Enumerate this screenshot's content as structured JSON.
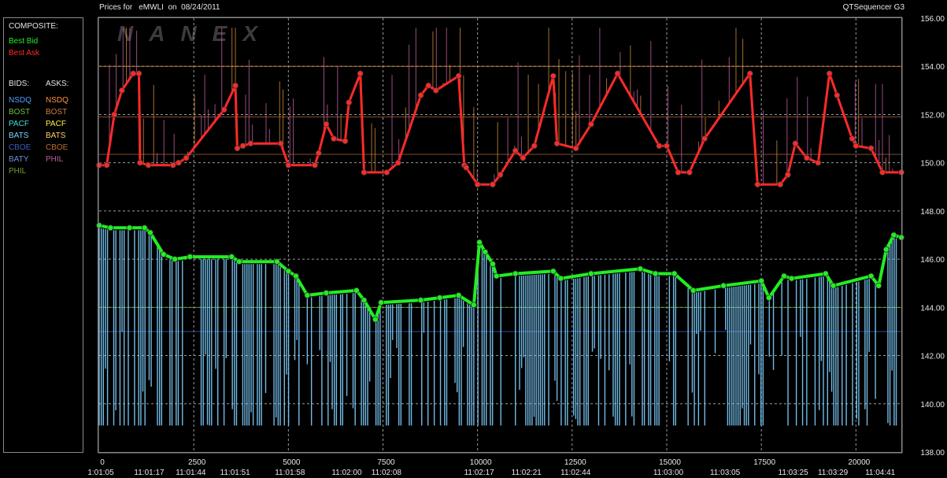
{
  "header": {
    "prices_label": "Prices for",
    "symbol": "eMWLI",
    "on_label": "on",
    "date": "08/24/2011",
    "app_name": "QTSequencer G3"
  },
  "watermark": "NANEX",
  "legend": {
    "composite_header": "COMPOSITE:",
    "best_bid": {
      "label": "Best Bid",
      "color": "#22ee22"
    },
    "best_ask": {
      "label": "Best Ask",
      "color": "#ff2a2a"
    },
    "bids_header": "BIDS:",
    "asks_header": "ASKS:",
    "bids": [
      {
        "label": "NSDQ",
        "color": "#4f9fff"
      },
      {
        "label": "BOST",
        "color": "#6fbf3f"
      },
      {
        "label": "PACF",
        "color": "#3fdfdf"
      },
      {
        "label": "BATS",
        "color": "#7fd0ff"
      },
      {
        "label": "CBOE",
        "color": "#3a5fbf"
      },
      {
        "label": "BATY",
        "color": "#6f8fdf"
      },
      {
        "label": "PHIL",
        "color": "#6f9f2f"
      }
    ],
    "asks": [
      {
        "label": "NSDQ",
        "color": "#ff8f3f"
      },
      {
        "label": "BOST",
        "color": "#d07f3f"
      },
      {
        "label": "PACF",
        "color": "#ffef3f"
      },
      {
        "label": "BATS",
        "color": "#ffcf6f"
      },
      {
        "label": "CBOE",
        "color": "#bf6f2f"
      },
      {
        "label": "PHIL",
        "color": "#bf5f9f"
      }
    ]
  },
  "chart_data": {
    "type": "line",
    "ylim": [
      138,
      156
    ],
    "xlim": [
      0,
      21200
    ],
    "y_ticks": [
      "138.00",
      "140.00",
      "142.00",
      "144.00",
      "146.00",
      "148.00",
      "150.00",
      "152.00",
      "154.00",
      "156.00"
    ],
    "x_ticks": [
      {
        "value": 0,
        "label": "0"
      },
      {
        "value": 2500,
        "label": "2500"
      },
      {
        "value": 5000,
        "label": "5000"
      },
      {
        "value": 7500,
        "label": "7500"
      },
      {
        "value": 10000,
        "label": "10000"
      },
      {
        "value": 12500,
        "label": "12500"
      },
      {
        "value": 15000,
        "label": "15000"
      },
      {
        "value": 17500,
        "label": "17500"
      },
      {
        "value": 20000,
        "label": "20000"
      }
    ],
    "time_labels": [
      {
        "x": 0,
        "label": "1:01:05"
      },
      {
        "x": 1280,
        "label": "11:01:17"
      },
      {
        "x": 2380,
        "label": "11:01:44"
      },
      {
        "x": 3550,
        "label": "11:01:51"
      },
      {
        "x": 5000,
        "label": "11:01:58"
      },
      {
        "x": 6500,
        "label": "11:02:00"
      },
      {
        "x": 7550,
        "label": "11:02:08"
      },
      {
        "x": 10000,
        "label": "11:02:17"
      },
      {
        "x": 11250,
        "label": "11:02:21"
      },
      {
        "x": 12550,
        "label": "11:02:44"
      },
      {
        "x": 15000,
        "label": "11:03:00"
      },
      {
        "x": 16500,
        "label": "11:03:05"
      },
      {
        "x": 18300,
        "label": "11:03:25"
      },
      {
        "x": 19350,
        "label": "11:03:29"
      },
      {
        "x": 20600,
        "label": "11:04:41"
      }
    ],
    "grid": true,
    "series": [
      {
        "name": "Best Bid",
        "color": "#22ee22",
        "points": [
          [
            0,
            147.4
          ],
          [
            300,
            147.3
          ],
          [
            800,
            147.3
          ],
          [
            1200,
            147.3
          ],
          [
            1350,
            147.1
          ],
          [
            1700,
            146.2
          ],
          [
            2000,
            146.0
          ],
          [
            2400,
            146.1
          ],
          [
            3500,
            146.1
          ],
          [
            3700,
            145.9
          ],
          [
            4700,
            145.9
          ],
          [
            5000,
            145.5
          ],
          [
            5200,
            145.3
          ],
          [
            5500,
            144.5
          ],
          [
            6000,
            144.6
          ],
          [
            6800,
            144.7
          ],
          [
            7000,
            144.3
          ],
          [
            7300,
            143.5
          ],
          [
            7450,
            144.2
          ],
          [
            8500,
            144.3
          ],
          [
            9000,
            144.4
          ],
          [
            9500,
            144.5
          ],
          [
            9900,
            144.1
          ],
          [
            10050,
            146.7
          ],
          [
            10200,
            146.3
          ],
          [
            10400,
            145.8
          ],
          [
            10500,
            145.3
          ],
          [
            11000,
            145.4
          ],
          [
            12000,
            145.5
          ],
          [
            12200,
            145.2
          ],
          [
            13000,
            145.4
          ],
          [
            14300,
            145.6
          ],
          [
            14700,
            145.4
          ],
          [
            15200,
            145.4
          ],
          [
            15700,
            144.7
          ],
          [
            16500,
            144.9
          ],
          [
            17500,
            145.1
          ],
          [
            17700,
            144.4
          ],
          [
            18100,
            145.3
          ],
          [
            18300,
            145.2
          ],
          [
            19200,
            145.4
          ],
          [
            19400,
            144.9
          ],
          [
            20400,
            145.3
          ],
          [
            20600,
            144.9
          ],
          [
            20800,
            146.4
          ],
          [
            21000,
            147.0
          ],
          [
            21200,
            146.9
          ]
        ]
      },
      {
        "name": "Best Ask",
        "color": "#ff2a2a",
        "points": [
          [
            0,
            149.9
          ],
          [
            200,
            149.9
          ],
          [
            400,
            152.0
          ],
          [
            600,
            153.0
          ],
          [
            900,
            153.7
          ],
          [
            1050,
            153.7
          ],
          [
            1080,
            150.0
          ],
          [
            1300,
            149.9
          ],
          [
            1950,
            149.9
          ],
          [
            2100,
            150.0
          ],
          [
            2300,
            150.2
          ],
          [
            3300,
            152.2
          ],
          [
            3600,
            153.2
          ],
          [
            3650,
            150.6
          ],
          [
            3800,
            150.7
          ],
          [
            4000,
            150.8
          ],
          [
            4800,
            150.8
          ],
          [
            5000,
            149.9
          ],
          [
            5700,
            149.9
          ],
          [
            5800,
            150.4
          ],
          [
            6000,
            151.6
          ],
          [
            6200,
            151.0
          ],
          [
            6500,
            150.9
          ],
          [
            6600,
            152.5
          ],
          [
            6900,
            153.7
          ],
          [
            7000,
            149.6
          ],
          [
            7600,
            149.6
          ],
          [
            7900,
            150.0
          ],
          [
            8500,
            152.8
          ],
          [
            8700,
            153.2
          ],
          [
            8900,
            153.0
          ],
          [
            9500,
            153.6
          ],
          [
            9650,
            149.9
          ],
          [
            9700,
            149.8
          ],
          [
            10000,
            149.1
          ],
          [
            10400,
            149.1
          ],
          [
            10600,
            149.5
          ],
          [
            11000,
            150.5
          ],
          [
            11200,
            150.2
          ],
          [
            11500,
            150.7
          ],
          [
            12000,
            153.6
          ],
          [
            12100,
            150.8
          ],
          [
            12600,
            150.6
          ],
          [
            13000,
            151.6
          ],
          [
            13700,
            153.7
          ],
          [
            14800,
            150.7
          ],
          [
            15000,
            150.7
          ],
          [
            15300,
            149.6
          ],
          [
            15600,
            149.6
          ],
          [
            16000,
            151.0
          ],
          [
            17200,
            153.7
          ],
          [
            17400,
            149.1
          ],
          [
            18000,
            149.1
          ],
          [
            18200,
            149.5
          ],
          [
            18400,
            150.8
          ],
          [
            18700,
            150.2
          ],
          [
            19000,
            150.0
          ],
          [
            19300,
            153.7
          ],
          [
            19500,
            152.8
          ],
          [
            19900,
            151.0
          ],
          [
            20000,
            150.7
          ],
          [
            20400,
            150.6
          ],
          [
            20700,
            149.6
          ],
          [
            21200,
            149.6
          ]
        ]
      }
    ]
  }
}
